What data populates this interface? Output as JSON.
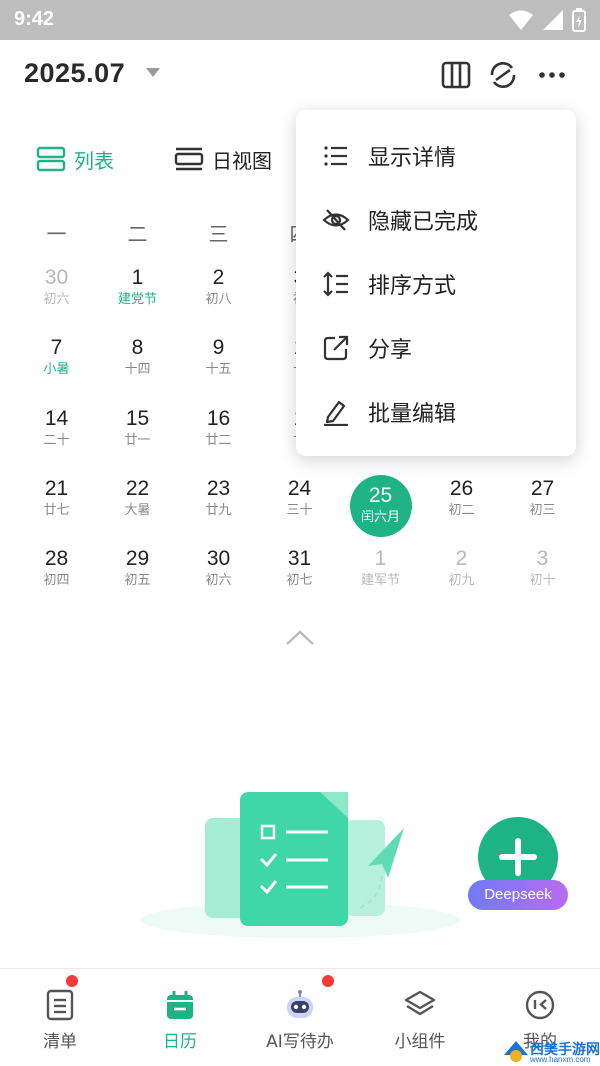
{
  "status_bar": {
    "time": "9:42"
  },
  "header": {
    "title": "2025.07"
  },
  "view_tabs": [
    {
      "label": "列表",
      "active": true
    },
    {
      "label": "日视图",
      "active": false
    }
  ],
  "weekdays": [
    "一",
    "二",
    "三",
    "四"
  ],
  "calendar": {
    "rows": [
      [
        {
          "num": "30",
          "lunar": "初六",
          "other": true
        },
        {
          "num": "1",
          "lunar": "建党节",
          "festival": true
        },
        {
          "num": "2",
          "lunar": "初八"
        },
        {
          "num": "3",
          "lunar": "初"
        }
      ],
      [
        {
          "num": "7",
          "lunar": "小暑",
          "festival": true
        },
        {
          "num": "8",
          "lunar": "十四"
        },
        {
          "num": "9",
          "lunar": "十五"
        },
        {
          "num": "1",
          "lunar": "十"
        }
      ],
      [
        {
          "num": "14",
          "lunar": "二十"
        },
        {
          "num": "15",
          "lunar": "廿一"
        },
        {
          "num": "16",
          "lunar": "廿二"
        },
        {
          "num": "1",
          "lunar": "廿"
        }
      ],
      [
        {
          "num": "21",
          "lunar": "廿七"
        },
        {
          "num": "22",
          "lunar": "大暑"
        },
        {
          "num": "23",
          "lunar": "廿九"
        },
        {
          "num": "24",
          "lunar": "三十"
        },
        {
          "num": "25",
          "lunar": "闰六月",
          "today": true
        },
        {
          "num": "26",
          "lunar": "初二"
        },
        {
          "num": "27",
          "lunar": "初三"
        }
      ],
      [
        {
          "num": "28",
          "lunar": "初四"
        },
        {
          "num": "29",
          "lunar": "初五"
        },
        {
          "num": "30",
          "lunar": "初六"
        },
        {
          "num": "31",
          "lunar": "初七"
        },
        {
          "num": "1",
          "lunar": "建军节",
          "other": true
        },
        {
          "num": "2",
          "lunar": "初九",
          "other": true
        },
        {
          "num": "3",
          "lunar": "初十",
          "other": true
        }
      ]
    ]
  },
  "menu": {
    "items": [
      {
        "label": "显示详情",
        "icon": "list-icon"
      },
      {
        "label": "隐藏已完成",
        "icon": "eye-hidden-icon"
      },
      {
        "label": "排序方式",
        "icon": "sort-icon"
      },
      {
        "label": "分享",
        "icon": "share-icon"
      },
      {
        "label": "批量编辑",
        "icon": "edit-icon"
      }
    ]
  },
  "fab": {
    "badge": "Deepseek"
  },
  "tabbar": {
    "items": [
      {
        "label": "清单",
        "icon": "checklist-icon",
        "dot": true
      },
      {
        "label": "日历",
        "icon": "calendar-icon",
        "active": true
      },
      {
        "label": "AI写待办",
        "icon": "robot-icon",
        "dot": true
      },
      {
        "label": "小组件",
        "icon": "layers-icon"
      },
      {
        "label": "我的",
        "icon": "profile-icon"
      }
    ]
  },
  "watermark": {
    "text": "西美手游网",
    "url": "www.hanxm.com"
  },
  "colors": {
    "accent": "#1db385",
    "badge_start": "#6f7bf6",
    "badge_end": "#b86bf0",
    "dot": "#f23a3a"
  }
}
